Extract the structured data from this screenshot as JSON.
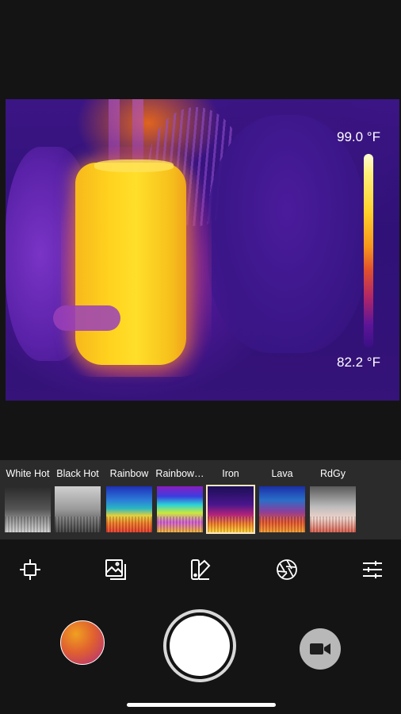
{
  "thermal": {
    "max_temp": "99.0 °F",
    "min_temp": "82.2 °F"
  },
  "palettes": [
    {
      "label": "White Hot",
      "selected": false
    },
    {
      "label": "Black Hot",
      "selected": false
    },
    {
      "label": "Rainbow",
      "selected": false
    },
    {
      "label": "Rainbow…",
      "selected": false
    },
    {
      "label": "Iron",
      "selected": true
    },
    {
      "label": "Lava",
      "selected": false
    },
    {
      "label": "RdGy",
      "selected": false
    }
  ],
  "tools": [
    "crosshair-icon",
    "gallery-icon",
    "palette-icon",
    "aperture-icon",
    "settings-sliders-icon"
  ],
  "colors": {
    "background": "#141414",
    "palette_strip": "#2b2b2b",
    "selected_outline": "#ffe6c2"
  }
}
